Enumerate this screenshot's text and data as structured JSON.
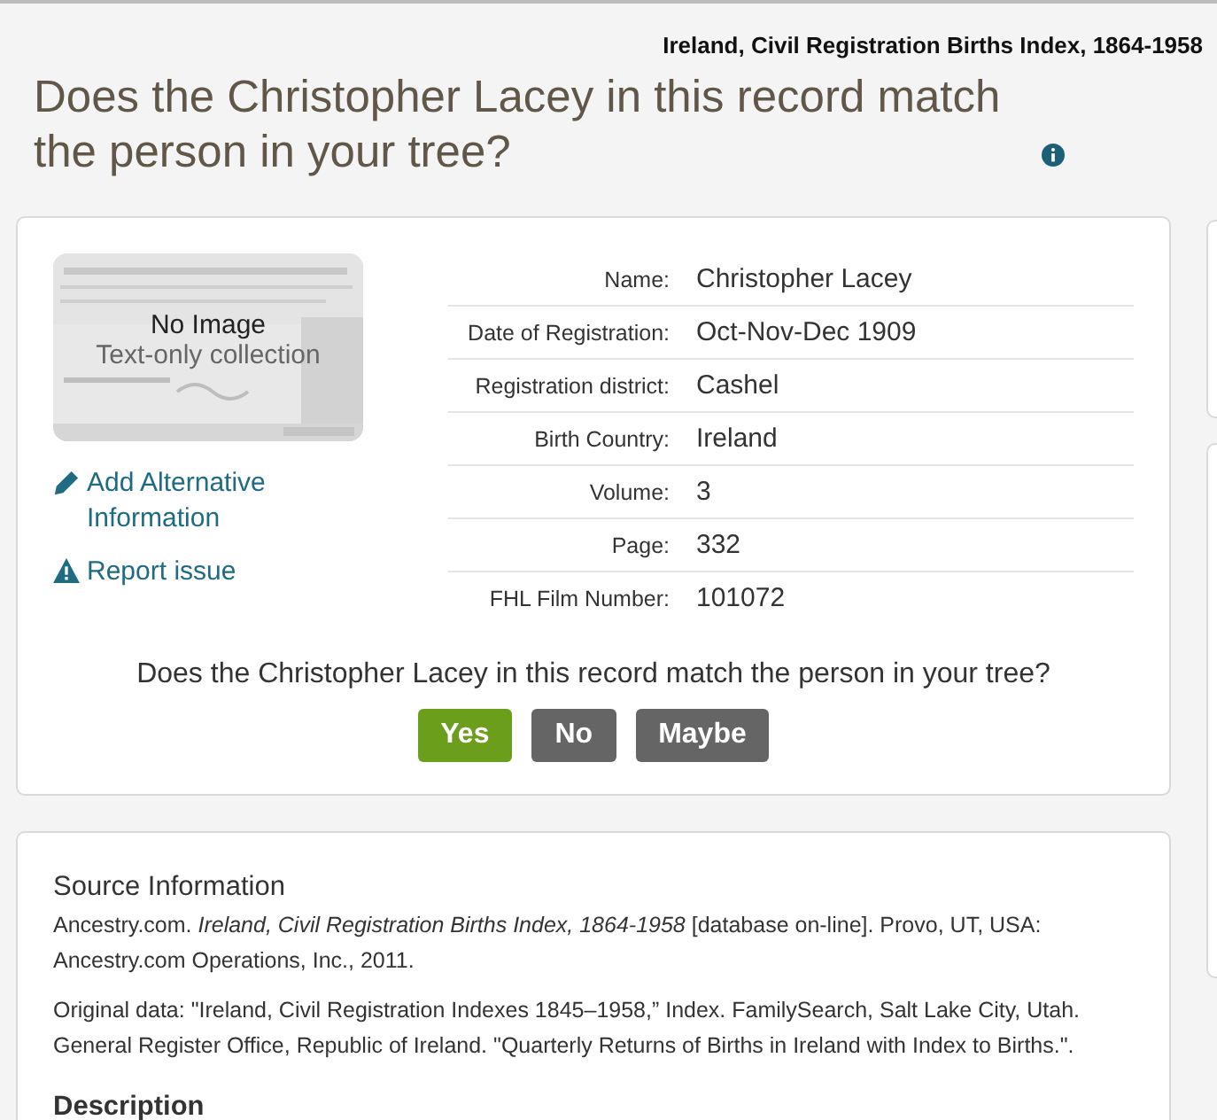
{
  "collection_title": "Ireland, Civil Registration Births Index, 1864-1958",
  "heading": "Does the Christopher Lacey in this record match the person in your tree?",
  "record": {
    "image": {
      "kind": "picture",
      "title": "No Image",
      "subtitle": "Text-only collection"
    },
    "links": [
      {
        "kind": "edit",
        "label": "Add Alternative Information"
      },
      {
        "kind": "warning",
        "label": "Report issue"
      }
    ],
    "fields": [
      {
        "label": "Name:",
        "value": "Christopher Lacey"
      },
      {
        "label": "Date of Registration:",
        "value": "Oct-Nov-Dec 1909"
      },
      {
        "label": "Registration district:",
        "value": "Cashel"
      },
      {
        "label": "Birth Country:",
        "value": "Ireland"
      },
      {
        "label": "Volume:",
        "value": "3"
      },
      {
        "label": "Page:",
        "value": "332"
      },
      {
        "label": "FHL Film Number:",
        "value": "101072"
      }
    ],
    "question": "Does the Christopher Lacey in this record match the person in your tree?",
    "answers": [
      {
        "label": "Yes",
        "kind": "primary"
      },
      {
        "label": "No",
        "kind": "secondary"
      },
      {
        "label": "Maybe",
        "kind": "secondary"
      }
    ]
  },
  "source": {
    "title": "Source Information",
    "paragraphs": [
      "Ancestry.com. *Ireland, Civil Registration Births Index, 1864-1958* [database on-line]. Provo, UT, USA: Ancestry.com Operations, Inc., 2011.",
      "Original data: \"Ireland, Civil Registration Indexes 1845–1958,” Index. FamilySearch, Salt Lake City, Utah. General Register Office, Republic of Ireland. \"Quarterly Returns of Births in Ireland with Index to Births.\"."
    ],
    "next_heading": "Description"
  }
}
